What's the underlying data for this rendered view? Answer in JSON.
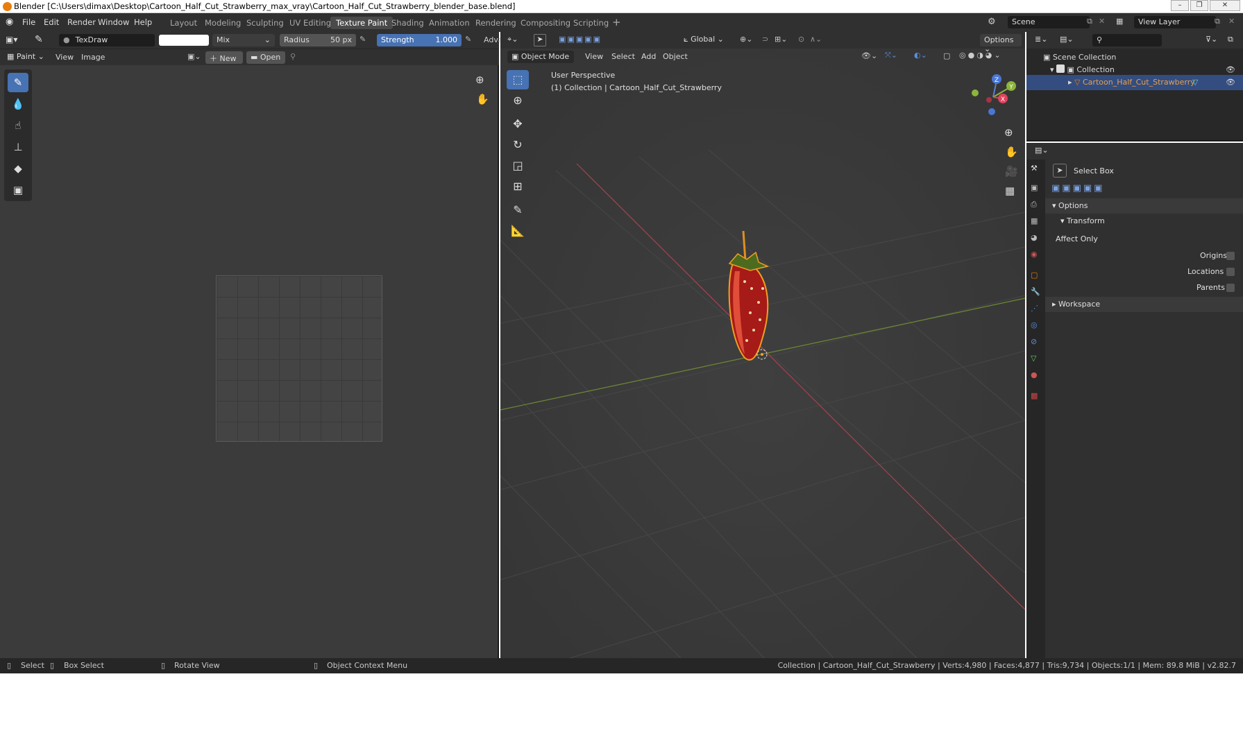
{
  "titlebar": {
    "title": "Blender [C:\\Users\\dimax\\Desktop\\Cartoon_Half_Cut_Strawberry_max_vray\\Cartoon_Half_Cut_Strawberry_blender_base.blend]"
  },
  "menu": {
    "file": "File",
    "edit": "Edit",
    "render": "Render",
    "window": "Window",
    "help": "Help"
  },
  "workspaces": [
    "Layout",
    "Modeling",
    "Sculpting",
    "UV Editing",
    "Texture Paint",
    "Shading",
    "Animation",
    "Rendering",
    "Compositing",
    "Scripting"
  ],
  "scene": {
    "name": "Scene",
    "view_layer": "View Layer"
  },
  "paint_header": {
    "brush": "TexDraw",
    "blend": "Mix",
    "radius_label": "Radius",
    "radius_value": "50 px",
    "strength_label": "Strength",
    "strength_value": "1.000",
    "adv": "Adva"
  },
  "image_header": {
    "mode": "Paint",
    "view": "View",
    "image": "Image",
    "new": "New",
    "open": "Open"
  },
  "viewport_header": {
    "orientation": "Global",
    "options": "Options",
    "mode": "Object Mode",
    "view": "View",
    "select": "Select",
    "add": "Add",
    "object": "Object"
  },
  "viewport_overlay": {
    "perspective": "User Perspective",
    "collection": "(1) Collection | Cartoon_Half_Cut_Strawberry"
  },
  "gizmo": {
    "x": "X",
    "y": "Y",
    "z": "Z"
  },
  "outliner": {
    "root": "Scene Collection",
    "collection": "Collection",
    "object": "Cartoon_Half_Cut_Strawberry"
  },
  "properties": {
    "tool_name": "Select Box",
    "options": "Options",
    "transform": "Transform",
    "affect_only": "Affect Only",
    "origins": "Origins",
    "locations": "Locations",
    "parents": "Parents",
    "workspace": "Workspace"
  },
  "statusbar": {
    "select": "Select",
    "box_select": "Box Select",
    "rotate_view": "Rotate View",
    "context_menu": "Object Context Menu",
    "info": "Collection | Cartoon_Half_Cut_Strawberry | Verts:4,980 | Faces:4,877 | Tris:9,734 | Objects:1/1 | Mem: 89.8 MiB | v2.82.7"
  },
  "colors": {
    "accent": "#4772b3",
    "selected_row": "#334d80",
    "object_orange": "#e87d0d"
  }
}
